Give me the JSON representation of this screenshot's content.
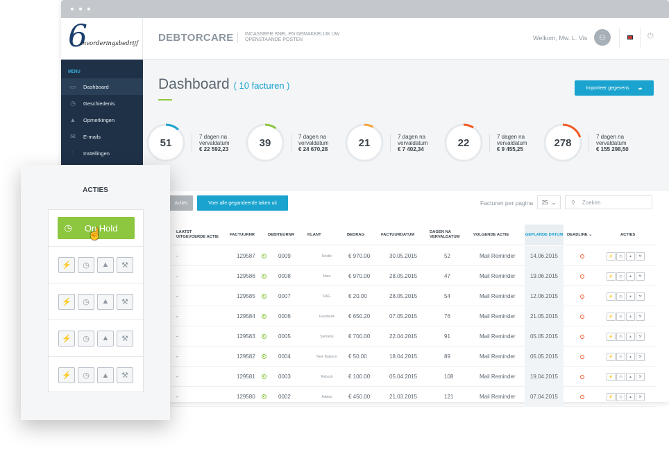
{
  "brand": {
    "logo_digit": "6",
    "logo_text": "invorderingsbedrijf",
    "name": "DEBTORCARE",
    "tagline": "INCASSEER SNEL EN GEMAKKELIJK UW OPENSTAANDE POSTEN"
  },
  "user": {
    "welcome_prefix": "Welkom,",
    "name": "Mw. L. Vis"
  },
  "sidebar": {
    "menu_title": "MENU",
    "items": [
      {
        "label": "Dashboard",
        "icon": "folder-icon",
        "glyph": "▭"
      },
      {
        "label": "Geschiedenis",
        "icon": "clock-icon",
        "glyph": "◷"
      },
      {
        "label": "Opmerkingen",
        "icon": "warning-icon",
        "glyph": "▲"
      },
      {
        "label": "E-mails",
        "icon": "mail-icon",
        "glyph": "✉"
      },
      {
        "label": "Instellingen",
        "icon": "settings-icon",
        "glyph": "⫶"
      }
    ]
  },
  "dashboard": {
    "title": "Dashboard",
    "subtitle": "( 10 facturen )",
    "import_label": "Importeer gegevens"
  },
  "stats": [
    {
      "value": "51",
      "line1": "7 dagen na",
      "line2": "vervaldatum",
      "amount": "€ 22 592,23",
      "color": "#1aa3cf",
      "fraction": 0.12
    },
    {
      "value": "39",
      "line1": "7 dagen na",
      "line2": "vervaldatum",
      "amount": "€ 24 670,28",
      "color": "#8dc63f",
      "fraction": 0.1
    },
    {
      "value": "21",
      "line1": "7 dagen na",
      "line2": "vervaldatum",
      "amount": "€ 7 402,34",
      "color": "#f7a23b",
      "fraction": 0.08
    },
    {
      "value": "22",
      "line1": "7 dagen na",
      "line2": "vervaldatum",
      "amount": "€ 9 455,25",
      "color": "#f15a24",
      "fraction": 0.09
    },
    {
      "value": "278",
      "line1": "7 dagen na",
      "line2": "vervaldatum",
      "amount": "€ 155 298,50",
      "color": "#f15a24",
      "fraction": 0.2
    }
  ],
  "toolbar": {
    "acties": "Acties",
    "voer": "Voer alle gegandeerde taken uit",
    "per_page_label": "Facturen per pagina",
    "per_page_value": "25",
    "search_placeholder": "Zoeken"
  },
  "table": {
    "headers": {
      "laatst": "LAATST UITGEVOERDE ACTIE",
      "factuurnr": "FACTUURNR",
      "debiteurnr": "DEBITEURNR",
      "klant": "KLANT",
      "bedrag": "BEDRAG",
      "factuurdatum": "FACTUURDATUM",
      "dagen": "DAGEN NA VERVALDATUM",
      "volgende": "VOLGENDE ACTIE",
      "gepland": "GEPLANDE DATUM",
      "deadline": "DEADLINE",
      "acties": "ACTIES"
    },
    "rows": [
      {
        "laatst": "-",
        "factuurnr": "129587",
        "debiteurnr": "0009",
        "klant": "Nestle",
        "bedrag": "€ 970.00",
        "factuurdatum": "30.05.2015",
        "dagen": "52",
        "volgende": "Mail Reminder",
        "gepland": "14.06.2015"
      },
      {
        "laatst": "-",
        "factuurnr": "129586",
        "debiteurnr": "0008",
        "klant": "Mars",
        "bedrag": "€ 970.00",
        "factuurdatum": "28.05.2015",
        "dagen": "47",
        "volgende": "Mail Reminder",
        "gepland": "19.06.2015"
      },
      {
        "laatst": "-",
        "factuurnr": "129585",
        "debiteurnr": "0007",
        "klant": "P&G",
        "bedrag": "€ 20.00",
        "factuurdatum": "28.05.2015",
        "dagen": "54",
        "volgende": "Mail Reminder",
        "gepland": "12.06.2015"
      },
      {
        "laatst": "-",
        "factuurnr": "129584",
        "debiteurnr": "0006",
        "klant": "Facebook",
        "bedrag": "€ 650.20",
        "factuurdatum": "07.05.2015",
        "dagen": "76",
        "volgende": "Mail Reminder",
        "gepland": "21.05.2015"
      },
      {
        "laatst": "-",
        "factuurnr": "129583",
        "debiteurnr": "0005",
        "klant": "Siemens",
        "bedrag": "€ 700.00",
        "factuurdatum": "22.04.2015",
        "dagen": "91",
        "volgende": "Mail Reminder",
        "gepland": "05.05.2015"
      },
      {
        "laatst": "-",
        "factuurnr": "129582",
        "debiteurnr": "0004",
        "klant": "New Balance",
        "bedrag": "€ 50.00",
        "factuurdatum": "18.04.2015",
        "dagen": "89",
        "volgende": "Mail Reminder",
        "gepland": "05.05.2015"
      },
      {
        "laatst": "-",
        "factuurnr": "129581",
        "debiteurnr": "0003",
        "klant": "Rebock",
        "bedrag": "€ 100.00",
        "factuurdatum": "05.04.2015",
        "dagen": "108",
        "volgende": "Mail Reminder",
        "gepland": "19.04.2015"
      },
      {
        "laatst": "-",
        "factuurnr": "129580",
        "debiteurnr": "0002",
        "klant": "Adidas",
        "bedrag": "€ 450.00",
        "factuurdatum": "21.03.2015",
        "dagen": "121",
        "volgende": "Mail Reminder",
        "gepland": "07.04.2015"
      }
    ]
  },
  "action_icons": [
    {
      "icon": "bolt-icon",
      "glyph": "⚡"
    },
    {
      "icon": "clock-icon",
      "glyph": "◷"
    },
    {
      "icon": "warning-icon",
      "glyph": "▲"
    },
    {
      "icon": "hammer-icon",
      "glyph": "⚒"
    }
  ],
  "card": {
    "title": "ACTIES",
    "onhold_label": "On Hold",
    "onhold_icon": "clock-icon"
  }
}
